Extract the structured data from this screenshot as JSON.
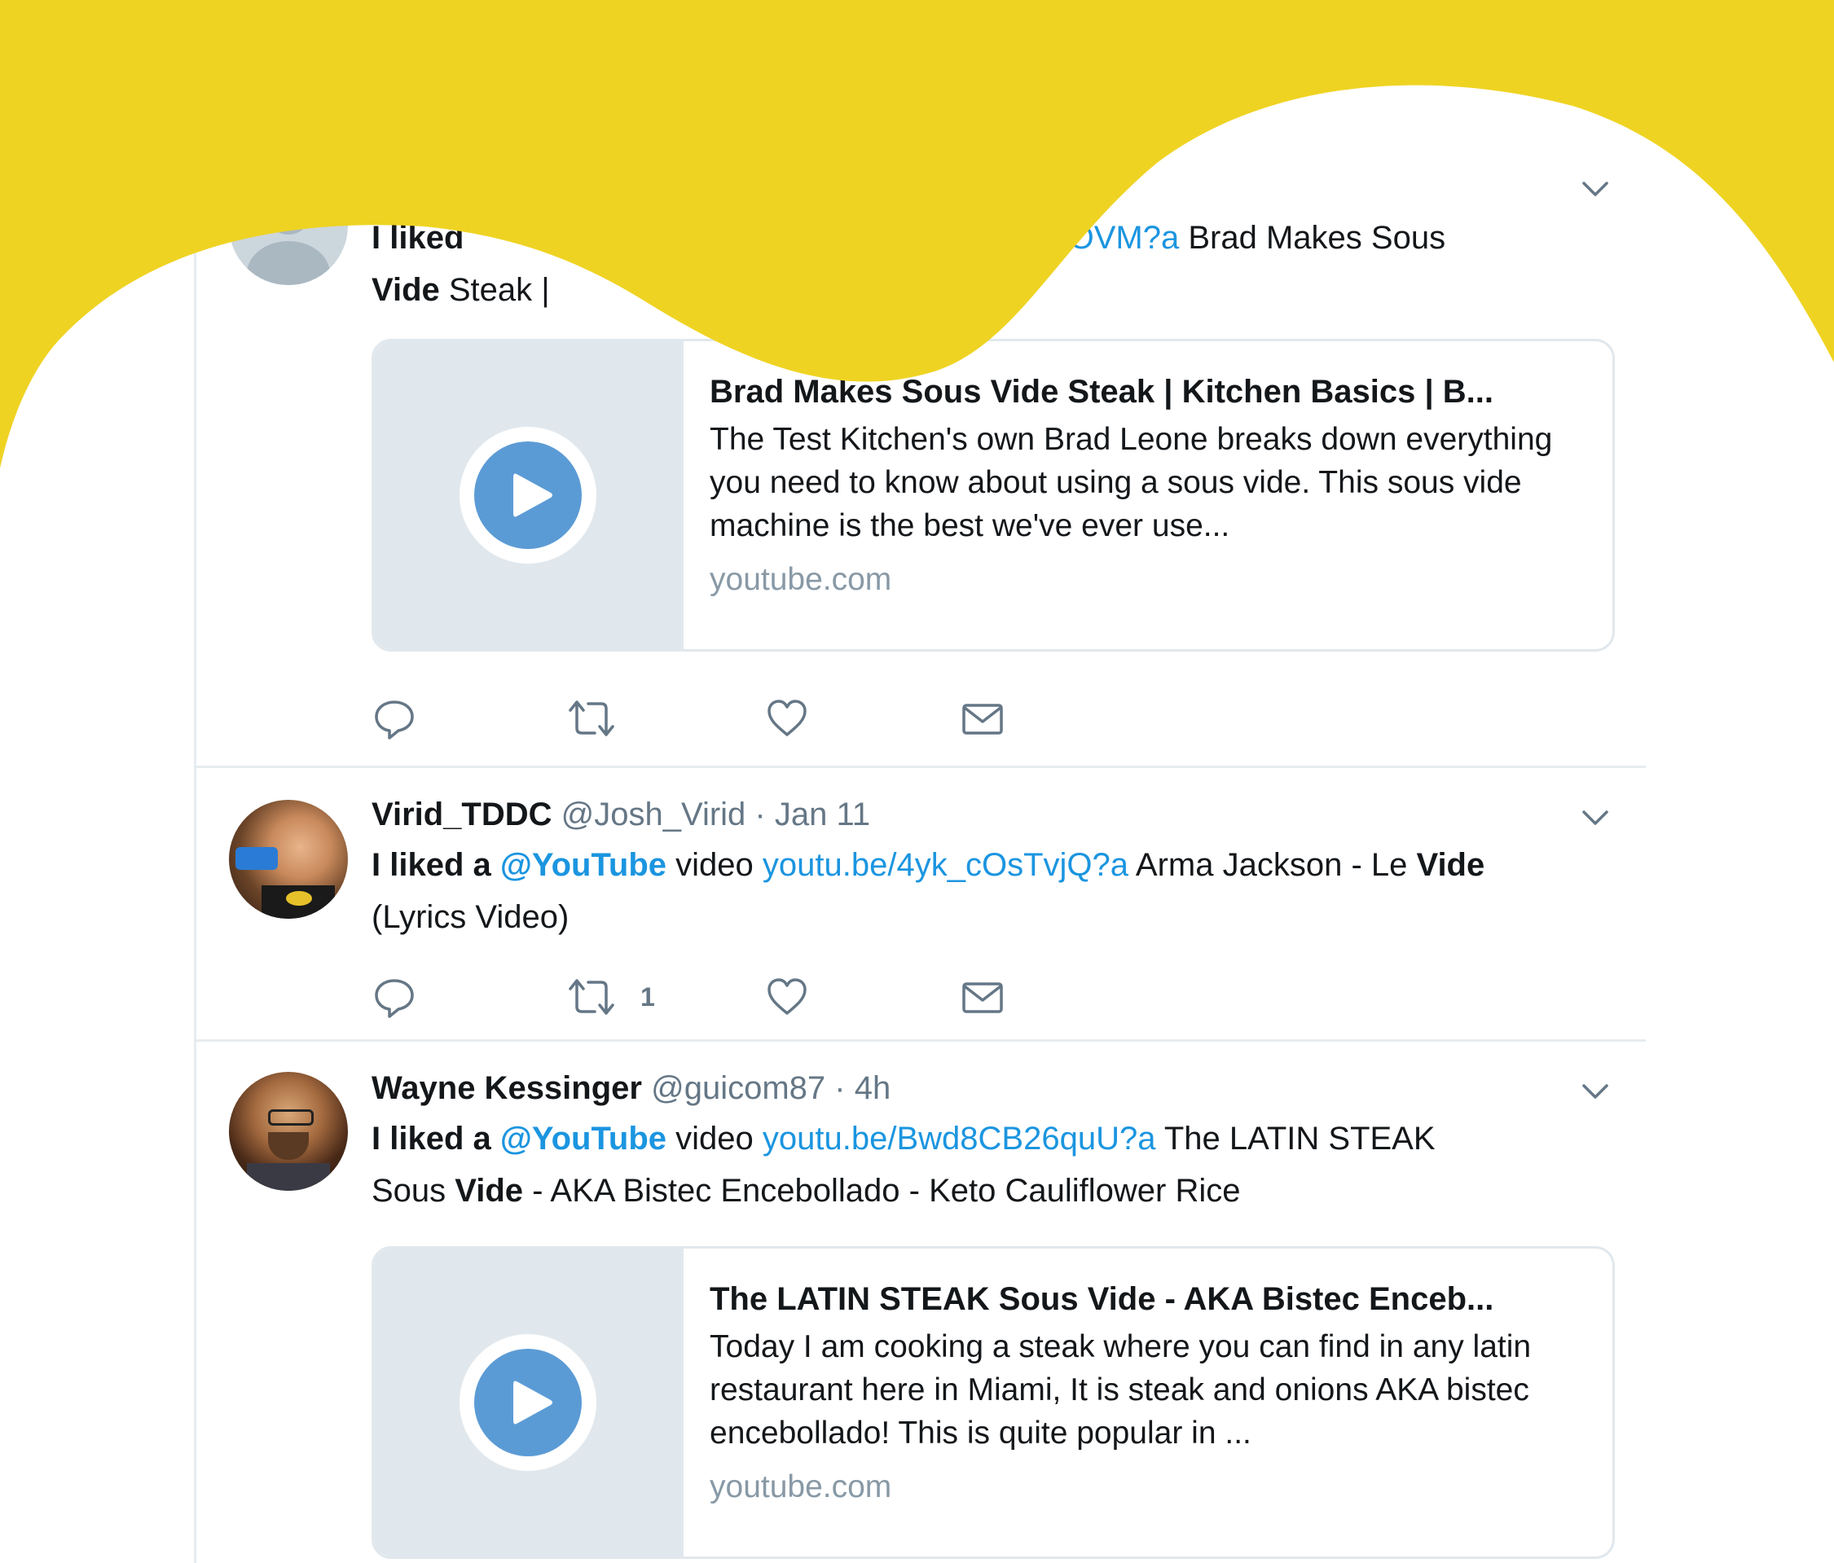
{
  "colors": {
    "accent_yellow": "#efd322",
    "link_blue": "#1b95e0",
    "play_blue": "#5b9bd5",
    "muted_gray": "#657786",
    "text_dark": "#14171a"
  },
  "tweets": [
    {
      "text_parts": {
        "visible_start": "I liked",
        "link_fragment": "OVM?a",
        "after_link": " Brad Makes Sous",
        "line2_bold": "Vide",
        "line2_rest": " Steak | "
      },
      "card": {
        "title": "Brad Makes Sous Vide Steak | Kitchen Basics | B...",
        "description": "The Test Kitchen's own Brad Leone breaks down everything you need to know about using a sous vide. This sous vide machine is the best we've ever use...",
        "domain": "youtube.com"
      },
      "actions": {
        "retweet_count": ""
      }
    },
    {
      "name": "Virid_TDDC",
      "handle": "@Josh_Virid",
      "sep": "·",
      "time": "Jan 11",
      "text_parts": {
        "pre": "I liked a ",
        "mention": "@YouTube",
        "mid": " video ",
        "link": "youtu.be/4yk_cOsTvjQ?a",
        "post": " Arma Jackson - Le ",
        "bold_word": "Vide",
        "line2": "(Lyrics Video)"
      },
      "actions": {
        "retweet_count": "1"
      }
    },
    {
      "name": "Wayne Kessinger",
      "handle": "@guicom87",
      "sep": "·",
      "time": "4h",
      "text_parts": {
        "pre": "I liked a ",
        "mention": "@YouTube",
        "mid": " video ",
        "link": "youtu.be/Bwd8CB26quU?a",
        "post": " The LATIN STEAK",
        "line2_pre": "Sous ",
        "bold_word": "Vide",
        "line2_post": " - AKA Bistec Encebollado - Keto Cauliflower Rice"
      },
      "card": {
        "title": "The LATIN STEAK Sous Vide - AKA Bistec Enceb...",
        "description": "Today I am cooking a steak where you can find in any latin restaurant here in Miami, It is steak and onions AKA bistec encebollado! This is quite popular in ...",
        "domain": "youtube.com"
      },
      "actions": {
        "retweet_count": ""
      }
    }
  ],
  "icons": {
    "reply": "reply-icon",
    "retweet": "retweet-icon",
    "like": "heart-icon",
    "dm": "envelope-icon",
    "menu": "chevron-down-icon",
    "play": "play-icon"
  }
}
